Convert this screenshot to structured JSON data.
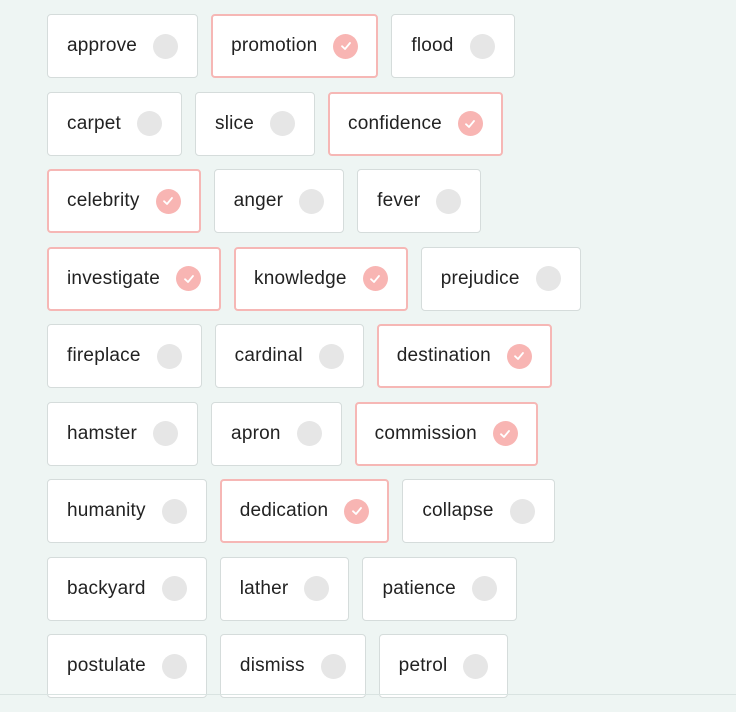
{
  "words": [
    [
      {
        "label": "approve",
        "selected": false
      },
      {
        "label": "promotion",
        "selected": true
      },
      {
        "label": "flood",
        "selected": false
      }
    ],
    [
      {
        "label": "carpet",
        "selected": false
      },
      {
        "label": "slice",
        "selected": false
      },
      {
        "label": "confidence",
        "selected": true
      }
    ],
    [
      {
        "label": "celebrity",
        "selected": true
      },
      {
        "label": "anger",
        "selected": false
      },
      {
        "label": "fever",
        "selected": false
      }
    ],
    [
      {
        "label": "investigate",
        "selected": true
      },
      {
        "label": "knowledge",
        "selected": true
      },
      {
        "label": "prejudice",
        "selected": false
      }
    ],
    [
      {
        "label": "fireplace",
        "selected": false
      },
      {
        "label": "cardinal",
        "selected": false
      },
      {
        "label": "destination",
        "selected": true
      }
    ],
    [
      {
        "label": "hamster",
        "selected": false
      },
      {
        "label": "apron",
        "selected": false
      },
      {
        "label": "commission",
        "selected": true
      }
    ],
    [
      {
        "label": "humanity",
        "selected": false
      },
      {
        "label": "dedication",
        "selected": true
      },
      {
        "label": "collapse",
        "selected": false
      }
    ],
    [
      {
        "label": "backyard",
        "selected": false
      },
      {
        "label": "lather",
        "selected": false
      },
      {
        "label": "patience",
        "selected": false
      }
    ],
    [
      {
        "label": "postulate",
        "selected": false
      },
      {
        "label": "dismiss",
        "selected": false
      },
      {
        "label": "petrol",
        "selected": false
      }
    ]
  ],
  "colors": {
    "background": "#eef5f3",
    "selected_border": "#f6b7b5",
    "selected_check": "#f8b5b3",
    "unselected_check": "#e6e6e6"
  },
  "icons": {
    "selected": "check-circle-icon",
    "unselected": "empty-circle-icon"
  }
}
